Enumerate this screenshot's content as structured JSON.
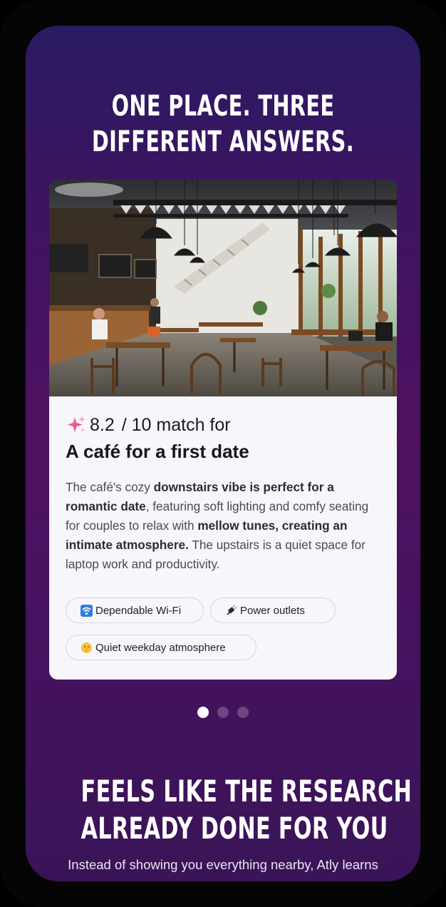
{
  "headline": {
    "line1": "One place. Three",
    "line2": "different answers."
  },
  "card": {
    "sparkle_icon": "sparkle-icon",
    "score": "8.2",
    "score_suffix": "/ 10 match for",
    "title": "A café for a first date",
    "description": {
      "t1": "The café's cozy ",
      "b1": "downstairs vibe is perfect for a romantic date",
      "t2": ", featuring soft lighting and comfy seating for couples to relax with ",
      "b2": "mellow tunes, creating an intimate atmosphere.",
      "t3": " The upstairs is a quiet space for laptop work and productivity."
    },
    "tags": [
      {
        "icon": "wifi-icon",
        "label": "Dependable Wi-Fi"
      },
      {
        "icon": "plug-icon",
        "label": "Power outlets"
      },
      {
        "icon": "shushing-face-icon",
        "label": "Quiet weekday atmosphere"
      }
    ]
  },
  "carousel": {
    "current_page": 1,
    "total_pages": 3
  },
  "section2": {
    "line1": "Feels like the research was",
    "line2": "already done for you",
    "intro": "Instead of showing you everything nearby, Atly learns"
  },
  "colors": {
    "background_top": "#2a1b63",
    "background_mid": "#4f1160",
    "card_background": "#f7f6fa",
    "text_dark": "#17171c"
  }
}
